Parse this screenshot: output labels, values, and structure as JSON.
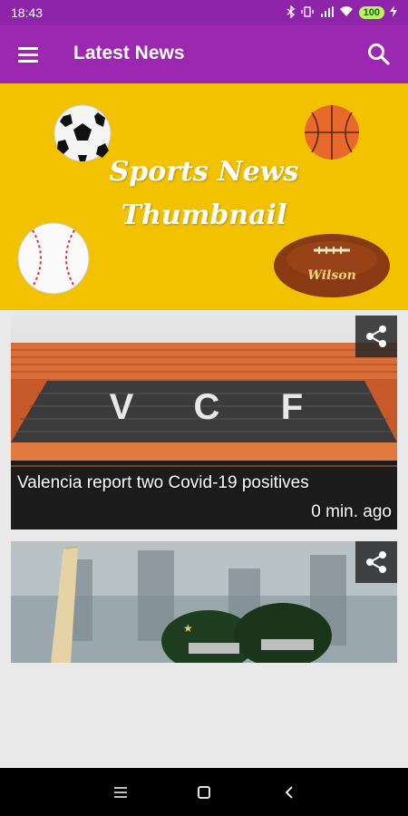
{
  "status_bar": {
    "time": "18:43",
    "battery": "100",
    "icons": [
      "bluetooth-icon",
      "vibrate-icon",
      "signal-icon",
      "wifi-icon",
      "battery-icon",
      "charging-icon"
    ]
  },
  "app_bar": {
    "title": "Latest News",
    "menu_icon": "menu-icon",
    "search_icon": "search-icon",
    "color": "#9c27b0"
  },
  "banner": {
    "line1": "Sports News",
    "line2": "Thumbnail",
    "background": "#f2c200",
    "ball_label": "Wilson"
  },
  "articles": [
    {
      "title": "Valencia report two Covid-19 positives",
      "time": "0 min. ago",
      "stadium_letters": [
        "V",
        "C",
        "F"
      ]
    },
    {
      "title": "",
      "time": ""
    }
  ],
  "nav_bar": {
    "buttons": [
      "recents-icon",
      "home-icon",
      "back-icon"
    ]
  }
}
